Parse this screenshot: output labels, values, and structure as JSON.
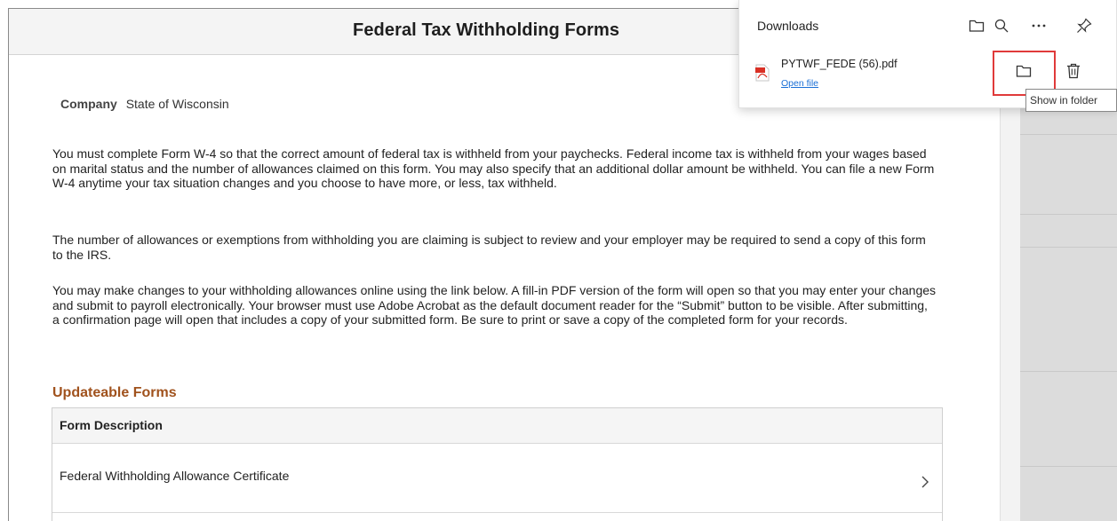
{
  "page": {
    "title": "Federal Tax Withholding Forms",
    "company_label": "Company",
    "company_value": "State of Wisconsin"
  },
  "paragraphs": [
    "You must complete Form W-4 so that the correct amount of federal tax is withheld from your paychecks. Federal income tax is withheld from your wages based on marital status and the number of allowances claimed on this form. You may also specify that an additional dollar amount be withheld. You can file a new Form W-4 anytime your tax situation changes and you choose to have more, or less, tax withheld.",
    "The number of allowances or exemptions from withholding you are claiming is subject to review and your employer may be required to send a copy of this form to the IRS.",
    "You may make changes to your withholding allowances online using the link below.  A fill-in PDF version of the form will open so that you may enter your changes and submit to payroll electronically. Your browser must use Adobe Acrobat as the default document reader for the “Submit” button to be visible.  After submitting, a confirmation page will open that includes a copy of your submitted form.  Be sure to print or save a copy of the completed form for your records."
  ],
  "forms": {
    "section_title": "Updateable Forms",
    "column_header": "Form Description",
    "rows": [
      {
        "label": "Federal Withholding Allowance Certificate"
      }
    ]
  },
  "downloads": {
    "title": "Downloads",
    "item": {
      "filename": "PYTWF_FEDE (56).pdf",
      "open_link": "Open file"
    },
    "tooltip": "Show in folder",
    "icons": {
      "open_folder": "folder-icon",
      "search": "search-icon",
      "more": "more-icon",
      "pin": "pin-icon",
      "show_in_folder": "folder-icon",
      "delete": "trash-icon",
      "file": "pdf-icon"
    }
  },
  "colors": {
    "section_title": "#a0521d",
    "link": "#1a6fd6",
    "highlight": "#e03a3a",
    "pdf_red": "#d93025"
  }
}
